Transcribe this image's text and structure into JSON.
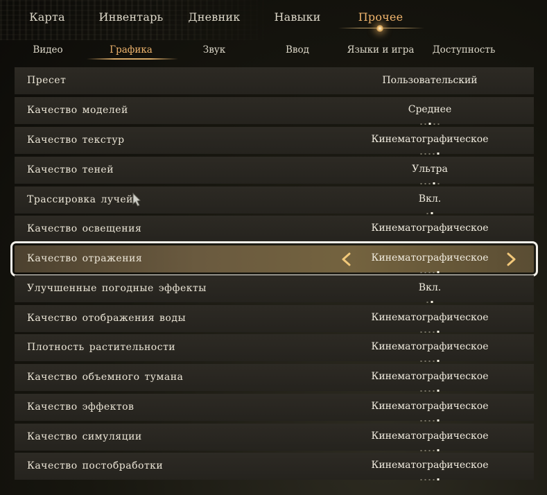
{
  "top_tabs": [
    {
      "label": "Карта",
      "active": false
    },
    {
      "label": "Инвентарь",
      "active": false
    },
    {
      "label": "Дневник",
      "active": false
    },
    {
      "label": "Навыки",
      "active": false
    },
    {
      "label": "Прочее",
      "active": true
    }
  ],
  "sub_tabs": [
    {
      "label": "Видео",
      "active": false
    },
    {
      "label": "Графика",
      "active": true
    },
    {
      "label": "Звук",
      "active": false
    },
    {
      "label": "Ввод",
      "active": false
    },
    {
      "label": "Языки и игра",
      "active": false
    },
    {
      "label": "Доступность",
      "active": false
    }
  ],
  "settings": [
    {
      "label": "Пресет",
      "value": "Пользовательский",
      "ticks": 0,
      "selected_tick": null
    },
    {
      "label": "Качество моделей",
      "value": "Среднее",
      "ticks": 5,
      "selected_tick": 2
    },
    {
      "label": "Качество текстур",
      "value": "Кинематографическое",
      "ticks": 5,
      "selected_tick": 4
    },
    {
      "label": "Качество теней",
      "value": "Ультра",
      "ticks": 5,
      "selected_tick": 3
    },
    {
      "label": "Трассировка лучей",
      "value": "Вкл.",
      "ticks": 2,
      "selected_tick": 1
    },
    {
      "label": "Качество освещения",
      "value": "Кинематографическое",
      "ticks": 5,
      "selected_tick": 4
    },
    {
      "label": "Качество отражения",
      "value": "Кинематографическое",
      "ticks": 5,
      "selected_tick": 4,
      "selected": true
    },
    {
      "label": "Улучшенные погодные эффекты",
      "value": "Вкл.",
      "ticks": 2,
      "selected_tick": 1
    },
    {
      "label": "Качество отображения воды",
      "value": "Кинематографическое",
      "ticks": 5,
      "selected_tick": 4
    },
    {
      "label": "Плотность растительности",
      "value": "Кинематографическое",
      "ticks": 5,
      "selected_tick": 4
    },
    {
      "label": "Качество объемного тумана",
      "value": "Кинематографическое",
      "ticks": 5,
      "selected_tick": 4
    },
    {
      "label": "Качество эффектов",
      "value": "Кинематографическое",
      "ticks": 5,
      "selected_tick": 4
    },
    {
      "label": "Качество симуляции",
      "value": "Кинематографическое",
      "ticks": 5,
      "selected_tick": 4
    },
    {
      "label": "Качество постобработки",
      "value": "Кинематографическое",
      "ticks": 5,
      "selected_tick": 4
    }
  ],
  "colors": {
    "accent": "#f0b56e",
    "row_background": "#2a2722",
    "selected_row": "#6a5a3f",
    "selection_outline": "#f4f1ea"
  },
  "icons": {
    "prev": "chevron-left-icon",
    "next": "chevron-right-icon",
    "cursor": "cursor-icon"
  }
}
